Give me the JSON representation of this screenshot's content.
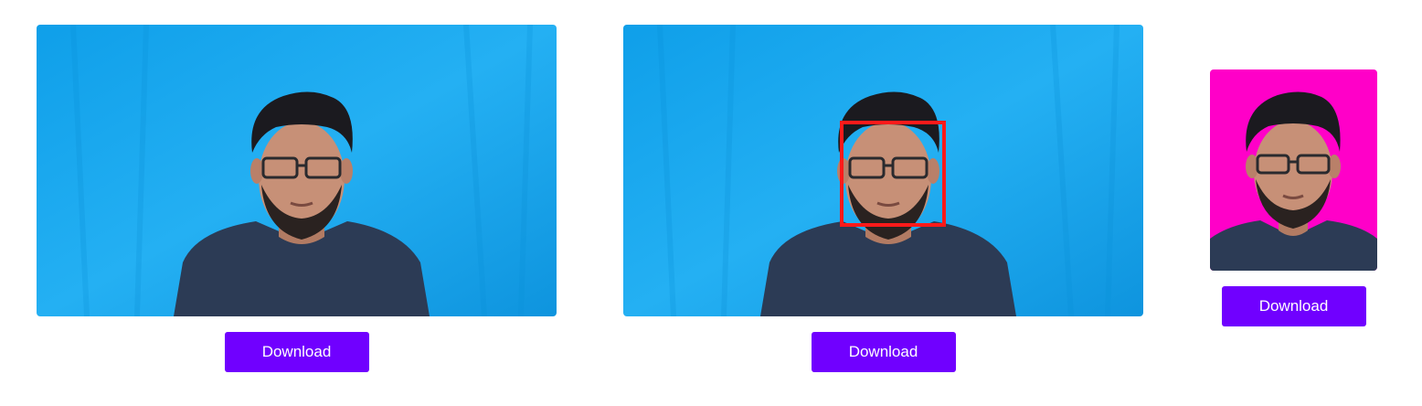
{
  "images": [
    {
      "name": "original-photo",
      "background": "#1fa9ef"
    },
    {
      "name": "face-detected-photo",
      "background": "#1fa9ef",
      "face_box_color": "#ff1a1a"
    },
    {
      "name": "passport-photo",
      "background": "#ff00c8"
    }
  ],
  "buttons": {
    "download_1": "Download",
    "download_2": "Download",
    "download_3": "Download"
  },
  "colors": {
    "accent": "#7000ff",
    "shirt": "#2c3b55",
    "hair": "#1b1a1f",
    "skin": "#c79077"
  }
}
